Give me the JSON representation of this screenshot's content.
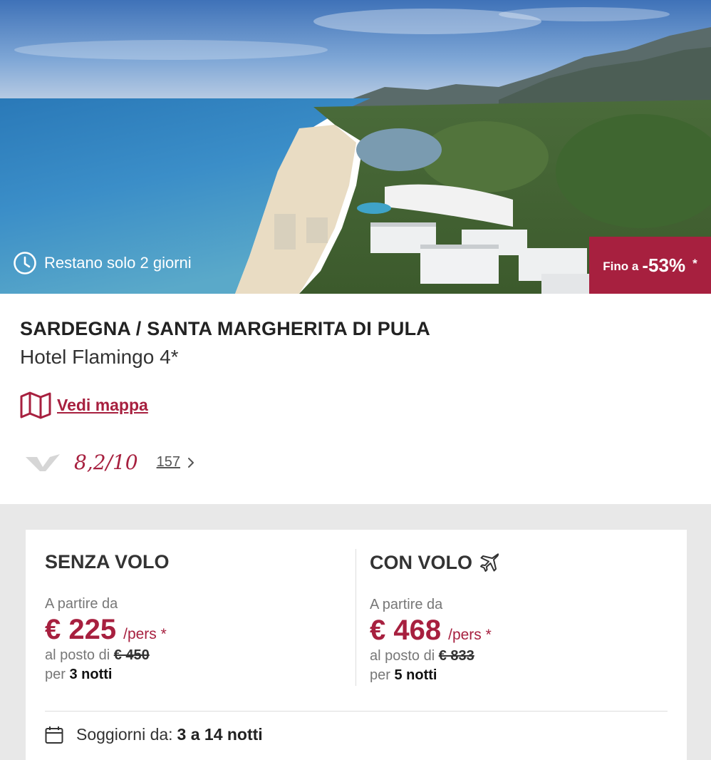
{
  "hero": {
    "countdown_text": "Restano solo 2 giorni",
    "discount_prefix": "Fino a",
    "discount_value": "-53%",
    "discount_star": "*"
  },
  "hotel": {
    "region": "SARDEGNA / SANTA MARGHERITA DI PULA",
    "name": "Hotel Flamingo 4*",
    "map_link": "Vedi mappa",
    "rating": "8,2/10",
    "reviews_count": "157"
  },
  "offers": {
    "without_flight": {
      "title": "SENZA VOLO",
      "from_label": "A partire da",
      "price": "€ 225",
      "per_person": "/pers *",
      "instead_label": "al posto di",
      "old_price": "€ 450",
      "per_label": "per",
      "nights": "3 notti"
    },
    "with_flight": {
      "title": "CON VOLO",
      "from_label": "A partire da",
      "price": "€ 468",
      "per_person": "/pers *",
      "instead_label": "al posto di",
      "old_price": "€ 833",
      "per_label": "per",
      "nights": "5 notti"
    }
  },
  "stay": {
    "label": "Soggiorni da:",
    "value": "3 a 14 notti"
  },
  "colors": {
    "accent": "#a7203f",
    "background_gray": "#e8e8e8"
  },
  "icons": [
    "clock-icon",
    "map-icon",
    "rating-logo-icon",
    "chevron-right-icon",
    "plane-icon",
    "calendar-icon"
  ]
}
